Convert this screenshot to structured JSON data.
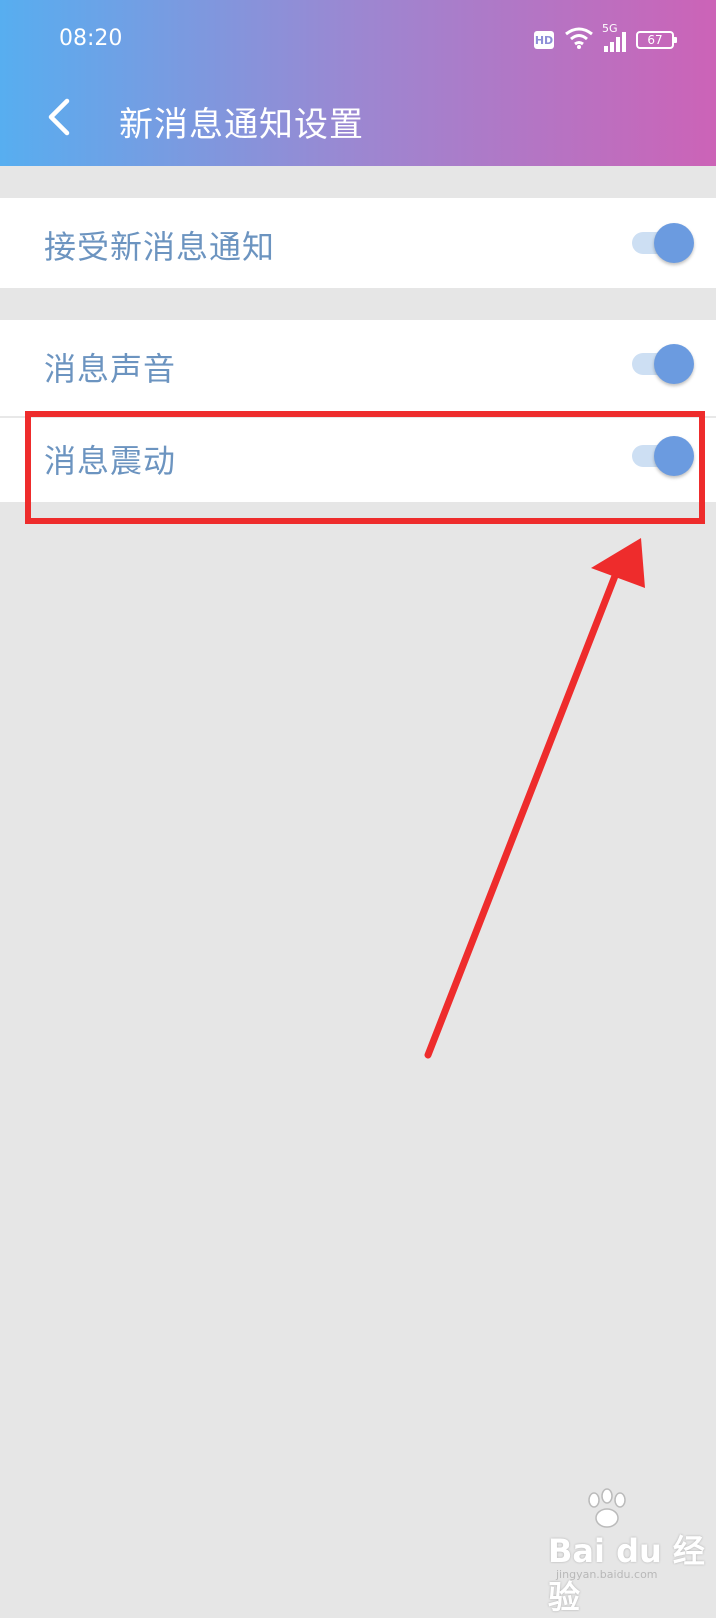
{
  "status_bar": {
    "time": "08:20",
    "hd_badge": "HD",
    "network": "5G",
    "battery": "67",
    "icons": [
      "hd-icon",
      "wifi-icon",
      "signal-5g-icon",
      "battery-icon"
    ]
  },
  "header": {
    "title": "新消息通知设置",
    "back_icon": "chevron-left-icon",
    "gradient": [
      "#57aef0",
      "#9c87d1",
      "#cc63b7"
    ]
  },
  "settings": [
    {
      "label": "接受新消息通知",
      "enabled": true
    },
    {
      "label": "消息声音",
      "enabled": true
    },
    {
      "label": "消息震动",
      "enabled": true
    }
  ],
  "colors": {
    "label_text": "#6c94c0",
    "toggle_knob": "#6b9be0",
    "toggle_track": "#cddff3",
    "highlight": "#ee2c2c"
  },
  "annotation": {
    "highlight_target": "消息震动",
    "arrow_points_to": "vibration-toggle"
  },
  "watermark": {
    "brand": "Bai du 经验",
    "url": "jingyan.baidu.com"
  }
}
